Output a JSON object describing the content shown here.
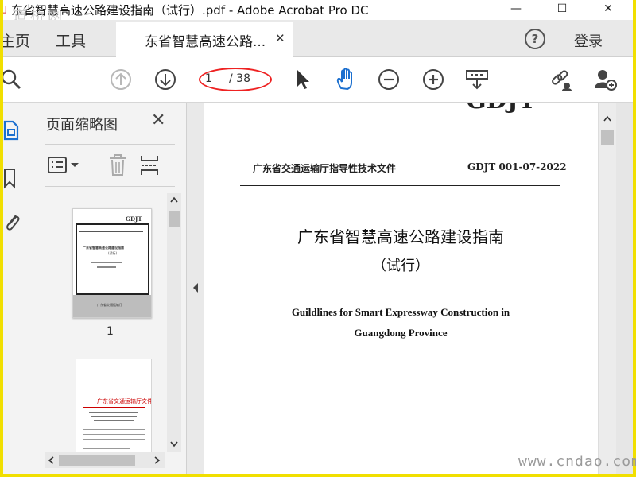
{
  "window": {
    "title": "东省智慧高速公路建设指南（试行）.pdf - Adobe Acrobat Pro DC",
    "minimize": "—",
    "maximize": "☐",
    "close": "✕"
  },
  "watermarks": {
    "top": "道桥网",
    "bottom": "www.cndao.com"
  },
  "tabs": {
    "home": "主页",
    "tools": "工具",
    "document": "东省智慧高速公路...",
    "document_close": "✕",
    "help": "?",
    "login": "登录"
  },
  "toolbar": {
    "page_current": "1",
    "page_total": "/ 38",
    "icons": [
      "search-icon",
      "page-up-icon",
      "page-down-icon",
      "select-cursor-icon",
      "hand-icon",
      "zoom-out-icon",
      "zoom-in-icon",
      "scroll-mode-icon",
      "share-link-icon",
      "add-user-icon"
    ]
  },
  "panel": {
    "title": "页面缩略图",
    "close": "✕",
    "thumbnail_page_label": "1",
    "thumb1": {
      "corner": "GDJT",
      "title": "广东省智慧高速公路建设指南",
      "sub": "(试行)",
      "footer": "广东省交通运输厅"
    },
    "thumb2": {
      "header": "广东省交通运输厅文件"
    }
  },
  "document": {
    "top_fragment": "GDJT",
    "header_left": "广东省交通运输厅指导性技术文件",
    "header_right": "GDJT 001-07-2022",
    "title": "广东省智慧高速公路建设指南",
    "subtitle": "（试行）",
    "english_line1": "Guildlines for Smart Expressway Construction in",
    "english_line2": "Guangdong Province"
  },
  "colors": {
    "frame": "#f1df00",
    "annotation_ellipse": "#e22222",
    "thumb2_header": "#cc0000"
  }
}
